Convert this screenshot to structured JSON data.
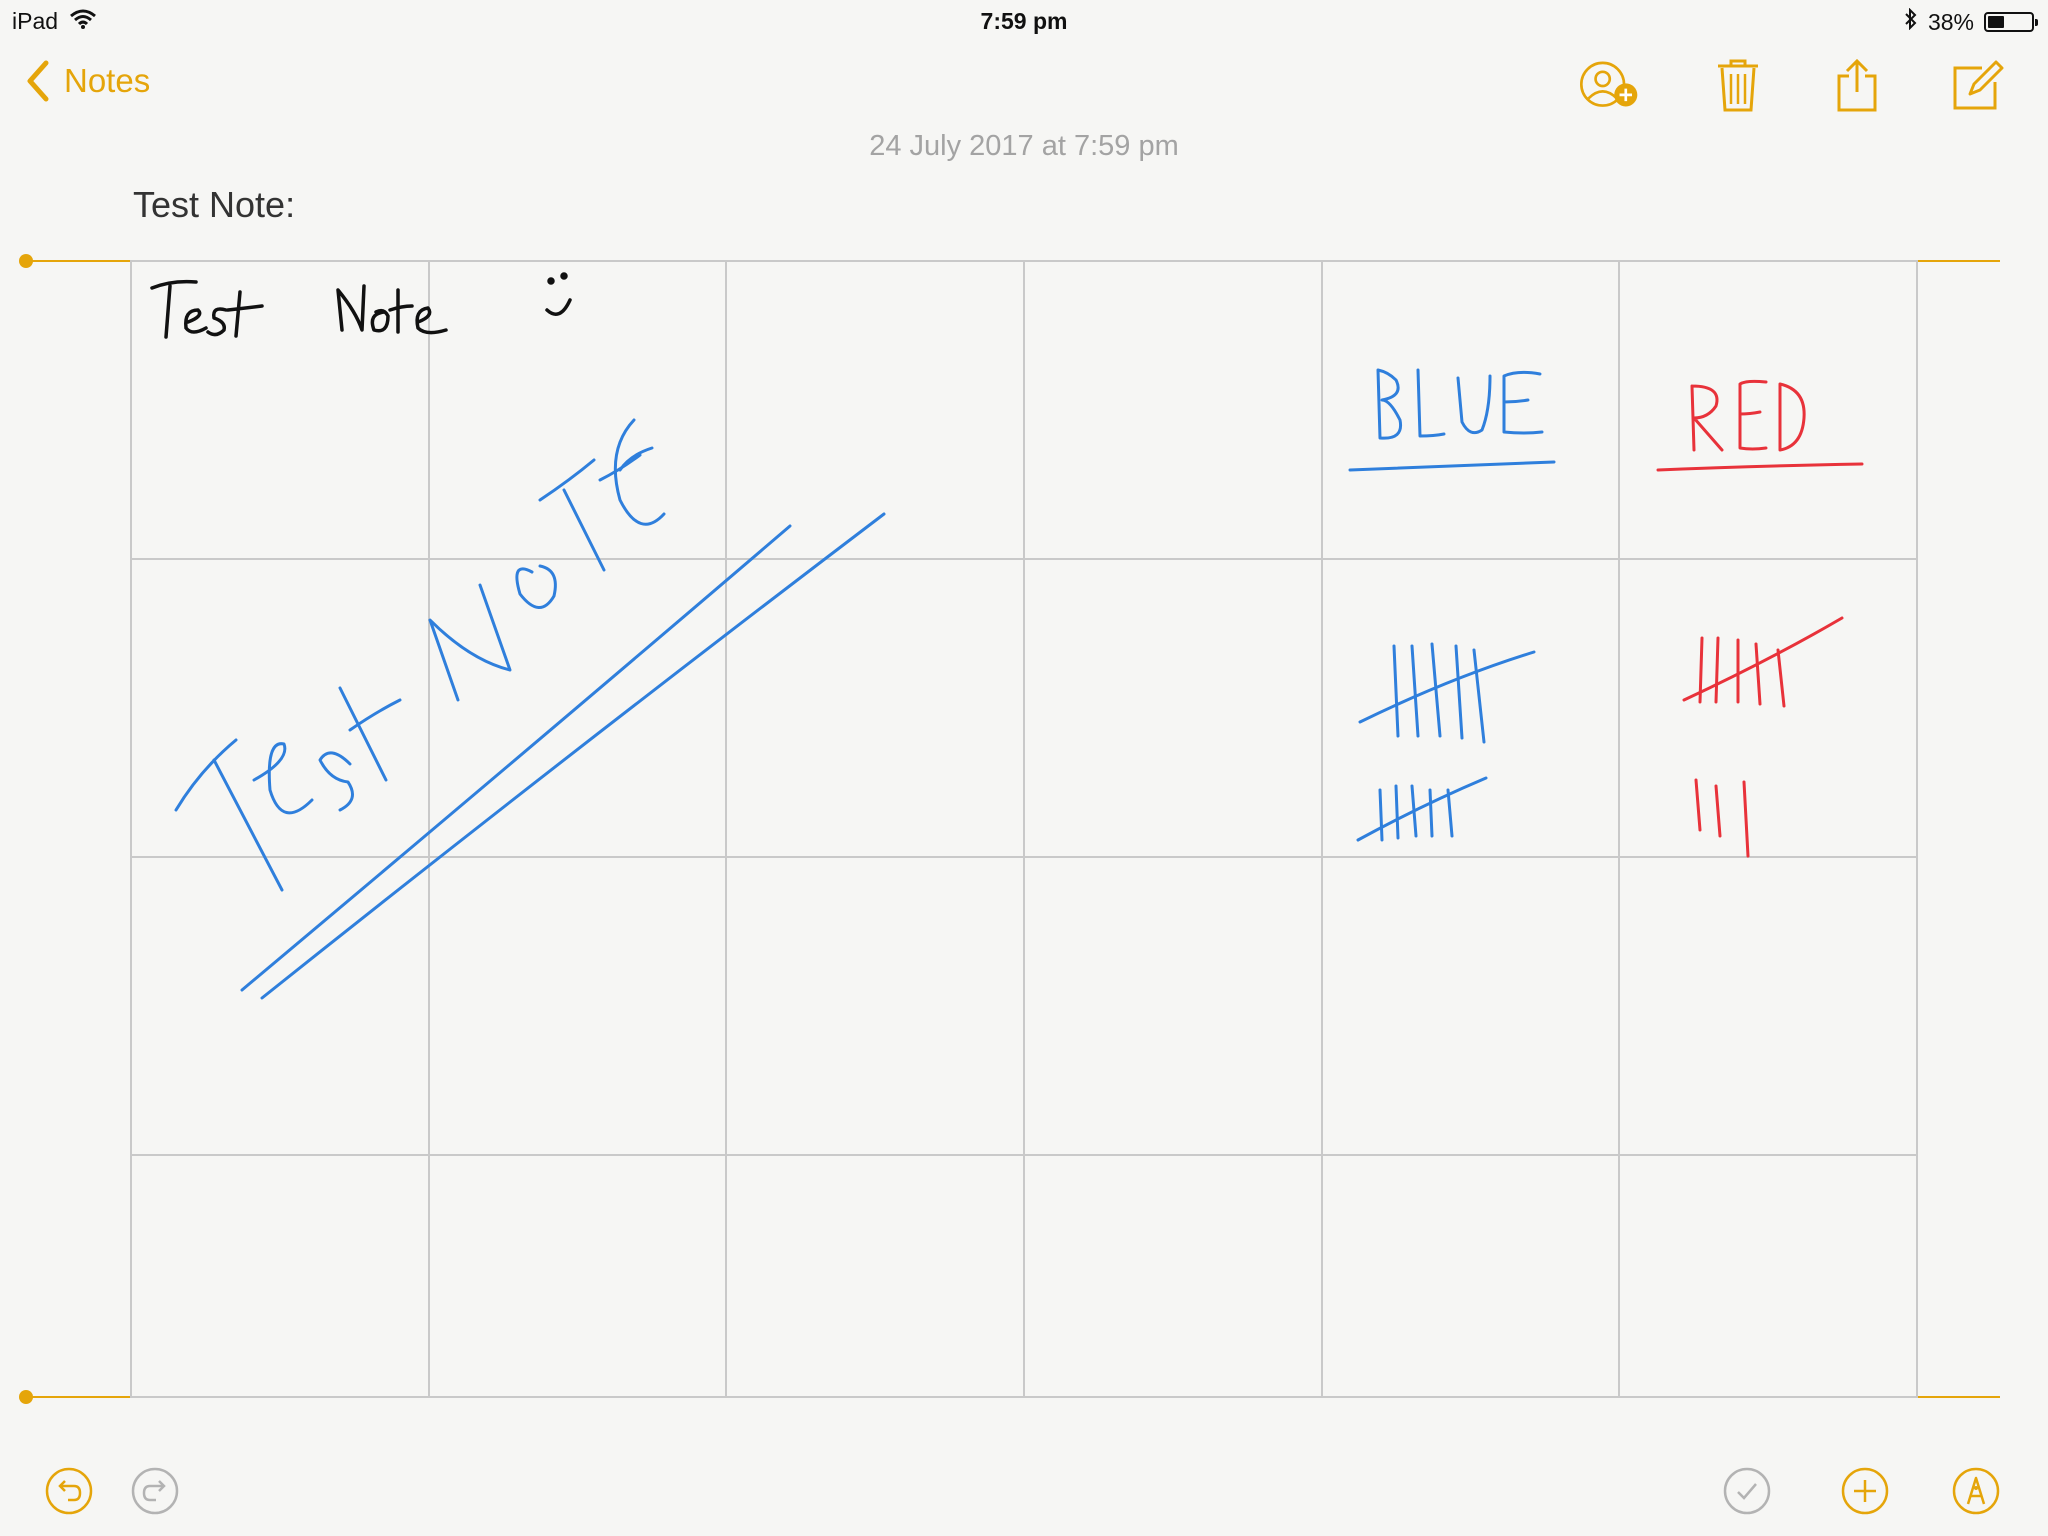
{
  "status_bar": {
    "device": "iPad",
    "time": "7:59 pm",
    "battery_text": "38%",
    "battery_level": 0.38
  },
  "nav": {
    "back_label": "Notes"
  },
  "note": {
    "date": "24 July 2017 at 7:59 pm",
    "title": "Test Note:"
  },
  "drawing": {
    "handwriting": {
      "top_left_black": "Test Note ;)",
      "diagonal_blue": "Test NOTE",
      "column_blue_header": "BLUE",
      "column_red_header": "RED"
    },
    "tallies": {
      "blue": 10,
      "red": 8
    }
  },
  "colors": {
    "accent": "#e5a50a",
    "ink_black": "#111111",
    "ink_blue": "#2f7fdc",
    "ink_red": "#e8323a",
    "grid": "#c9c9c9"
  },
  "toolbar": {
    "icons": [
      "add-person-icon",
      "trash-icon",
      "share-icon",
      "compose-icon"
    ],
    "bottom_icons": [
      "undo-icon",
      "redo-icon",
      "checklist-icon",
      "add-icon",
      "markup-pen-icon"
    ]
  }
}
